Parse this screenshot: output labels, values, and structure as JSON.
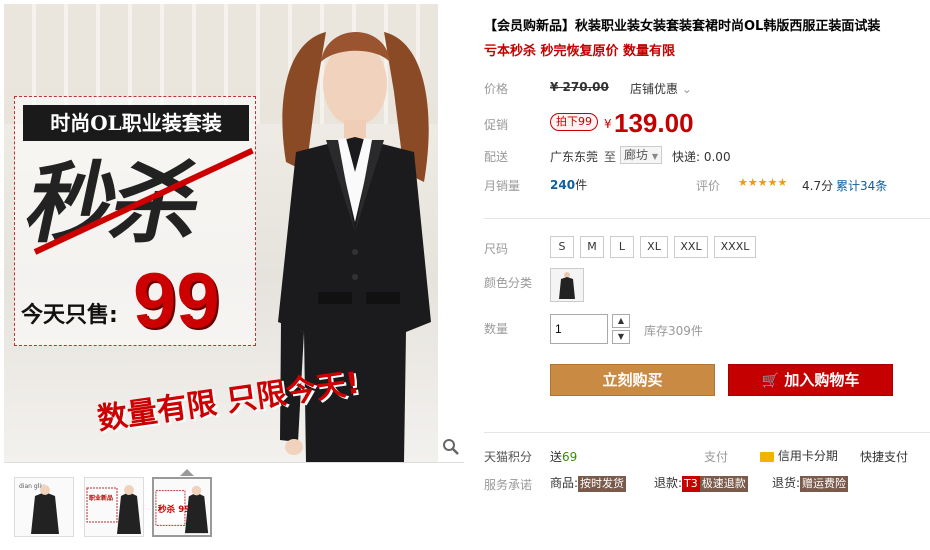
{
  "gallery": {
    "promo": {
      "title": "时尚OL职业装套装",
      "headline": "秒杀",
      "today_label": "今天只售:",
      "today_price": "99",
      "bottom_text": "数量有限 只限今天!"
    },
    "thumbs": [
      {
        "label": "dian gliu"
      },
      {
        "label": "职业新品"
      },
      {
        "label": "秒杀 99"
      }
    ],
    "zoom_icon": "magnifier-icon"
  },
  "product": {
    "title": "【会员购新品】秋装职业装女装套装套裙时尚OL韩版西服正装面试装",
    "subtitle": "亏本秒杀 秒完恢复原价 数量有限",
    "price_label": "价格",
    "original_price": "¥ 270.00",
    "shop_discount": "店铺优惠",
    "promo_label": "促销",
    "promo_tag": "拍下99",
    "yen": "¥",
    "promo_price": "139.00",
    "shipping_label": "配送",
    "shipping_from": "广东东莞",
    "shipping_to_label": "至",
    "shipping_to": "廊坊",
    "express": "快递: 0.00",
    "sales_label": "月销量",
    "sales_count": "240",
    "sales_unit": "件",
    "rating_label": "评价",
    "stars": "★★★★★",
    "rating_score": "4.7分",
    "rating_total": "累计34条",
    "size_label": "尺码",
    "sizes": [
      "S",
      "M",
      "L",
      "XL",
      "XXL",
      "XXXL"
    ],
    "color_label": "颜色分类",
    "qty_label": "数量",
    "qty_value": "1",
    "stock": "库存309件",
    "buy_now": "立刻购买",
    "add_cart": "加入购物车",
    "points_label": "天猫积分",
    "points_value": "送",
    "points_num": "69",
    "pay_label": "支付",
    "pay_credit": "信用卡分期",
    "pay_fast": "快捷支付",
    "promise_label": "服务承诺",
    "promise_goods": "商品:",
    "promise_goods_tag": "按时发货",
    "promise_refund": "退款:",
    "promise_refund_tag_t3": "T3",
    "promise_refund_tag": "极速退款",
    "promise_return": "退货:",
    "promise_return_tag": "赠运费险"
  },
  "colors": {
    "accent_red": "#c40000",
    "buy_orange": "#c98a44"
  }
}
